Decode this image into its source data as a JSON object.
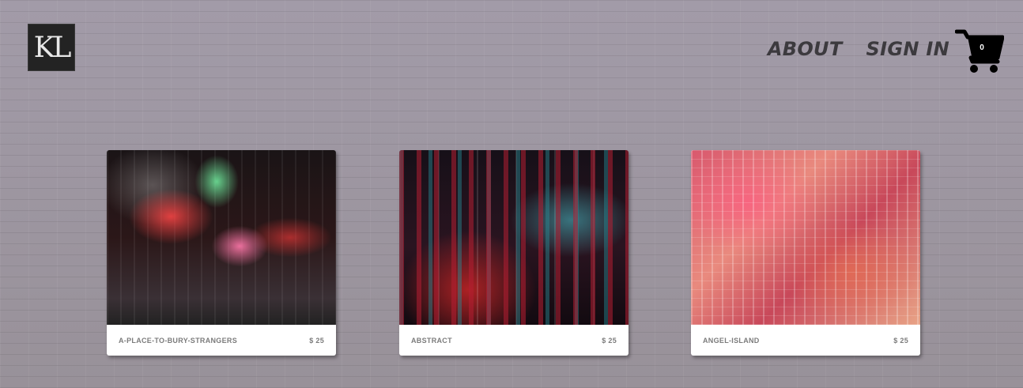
{
  "header": {
    "logo_text": "KL",
    "nav": [
      {
        "label": "ABOUT"
      },
      {
        "label": "SIGN IN"
      }
    ],
    "cart": {
      "count": "0",
      "icon": "shopping-cart-icon"
    }
  },
  "products": [
    {
      "title": "A-PLACE-TO-BURY-STRANGERS",
      "price": "$ 25"
    },
    {
      "title": "ABSTRACT",
      "price": "$ 25"
    },
    {
      "title": "ANGEL-ISLAND",
      "price": "$ 25"
    }
  ],
  "colors": {
    "background": "#9a93a0",
    "nav_text": "#3c3a3e",
    "card": "#ffffff",
    "card_text": "#7b7b7b"
  }
}
